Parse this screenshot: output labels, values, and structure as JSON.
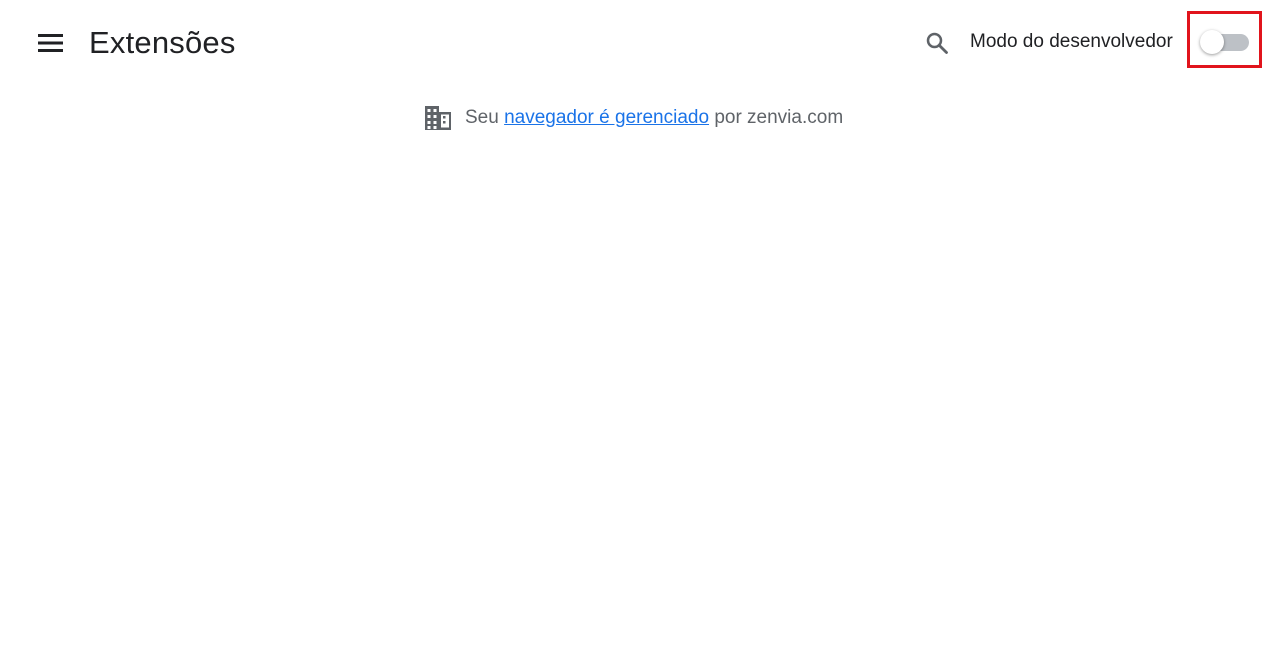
{
  "header": {
    "menu_icon": "hamburger-menu-icon",
    "title": "Extensões",
    "search_icon": "search-icon",
    "dev_mode_label": "Modo do desenvolvedor",
    "dev_mode_enabled": false
  },
  "managed_notice": {
    "icon": "building-icon",
    "prefix": "Seu",
    "link_text": "navegador é gerenciado",
    "suffix": "por zenvia.com"
  },
  "colors": {
    "text_primary": "#202124",
    "text_secondary": "#5f6368",
    "link": "#1a73e8",
    "toggle_track_off": "#bdc1c6",
    "highlight_border": "#e1141c"
  }
}
